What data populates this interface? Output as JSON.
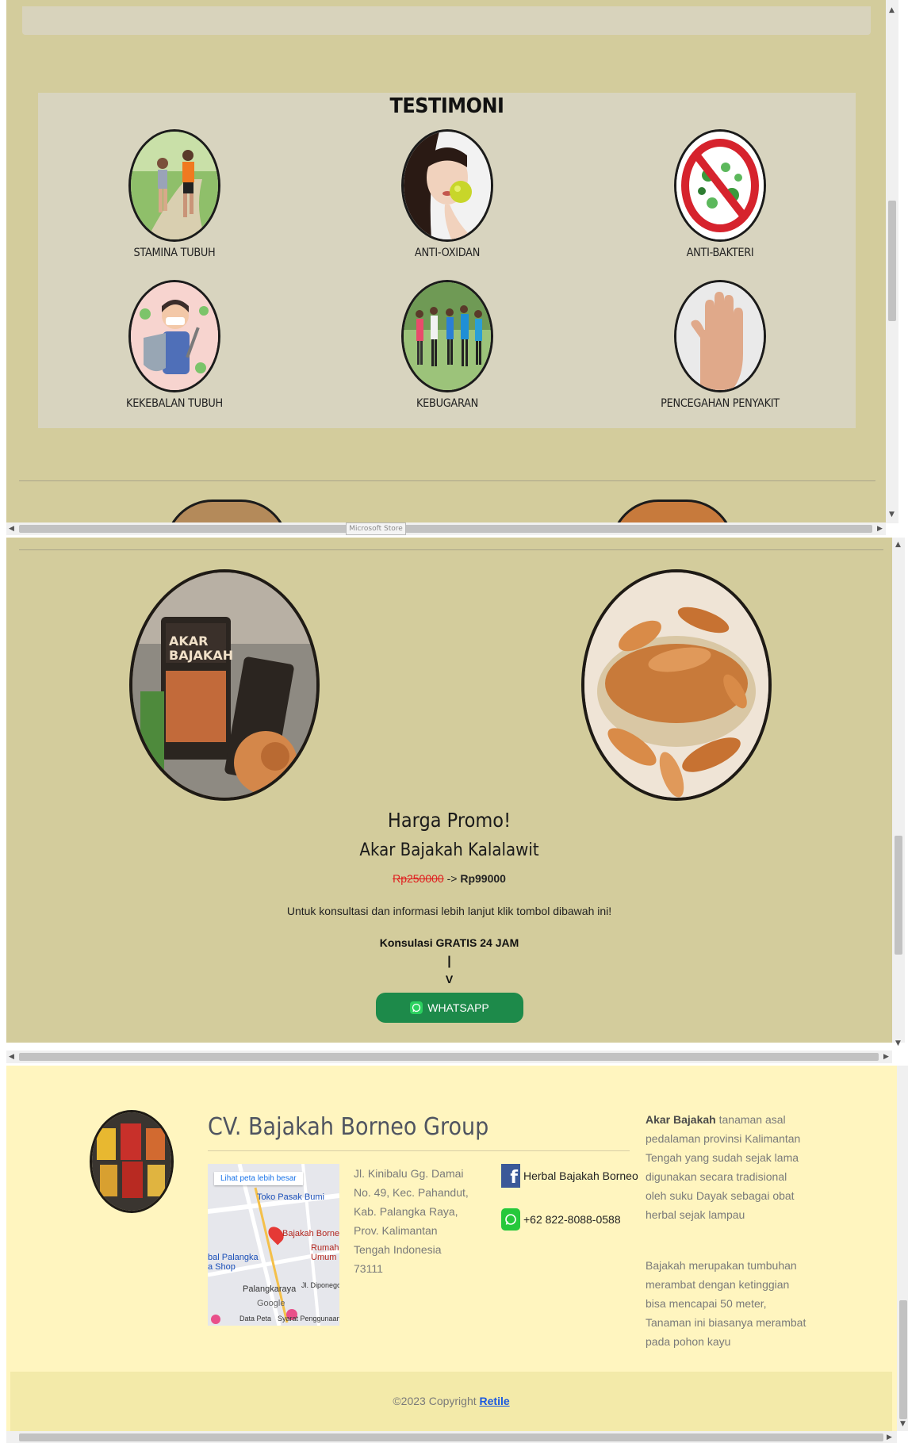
{
  "testimoni": {
    "title": "TESTIMONI",
    "items": [
      {
        "label": "STAMINA TUBUH"
      },
      {
        "label": "ANTI-OXIDAN"
      },
      {
        "label": "ANTI-BAKTERI"
      },
      {
        "label": "KEKEBALAN TUBUH"
      },
      {
        "label": "KEBUGARAN"
      },
      {
        "label": "PENCEGAHAN PENYAKIT"
      }
    ]
  },
  "window": {
    "tooltip": "Microsoft Store"
  },
  "promo": {
    "title": "Harga Promo!",
    "product": "Akar Bajakah Kalalawit",
    "price_old": "Rp250000",
    "price_arrow": "->",
    "price_new": "Rp99000",
    "info": "Untuk konsultasi dan informasi lebih lanjut klik tombol dibawah ini!",
    "konsul": "Konsulasi GRATIS 24 JAM",
    "pipe": "|",
    "arrow_v": "V",
    "whatsapp_label": "WHATSAPP",
    "image_text": [
      "AKAR",
      "BAJAKAH"
    ]
  },
  "footer": {
    "company": "CV. Bajakah Borneo Group",
    "map": {
      "link": "Lihat peta lebih besar",
      "labels": [
        "Toko Pasak Bumi",
        "Bajakah Borne",
        "Rumah",
        "Umum",
        "bal Palangka",
        "a Shop",
        "Palangkaraya",
        "Jl. Diponego",
        "Google",
        "Data Peta",
        "Syarat Penggunaan"
      ]
    },
    "address": "Jl. Kinibalu Gg. Damai No. 49, Kec. Pahandut, Kab. Palangka Raya, Prov. Kalimantan Tengah Indonesia 73111",
    "facebook": "Herbal Bajakah Borneo",
    "phone": "+62 822-8088-0588",
    "about_bold": "Akar Bajakah",
    "about_rest": " tanaman asal pedalaman provinsi Kalimantan Tengah yang sudah sejak lama digunakan secara tradisional oleh suku Dayak sebagai obat herbal sejak lampau",
    "about2": "Bajakah merupakan tumbuhan merambat dengan ketinggian bisa mencapai 50 meter, Tanaman ini biasanya merambat pada pohon kayu",
    "copyright": "©2023 Copyright ",
    "copyright_link": "Retile"
  },
  "colors": {
    "section_bg": "#d3cc9c",
    "card_bg": "#d8d4bf",
    "footer_bg": "#fff5bf",
    "footer_bar": "#f3eaa9",
    "whatsapp_green": "#1d8a4a",
    "price_old": "#e02020",
    "link_blue": "#1a58e0"
  },
  "icons": [
    "facebook-icon",
    "whatsapp-icon",
    "map-pin-icon",
    "scroll-arrow-icon"
  ]
}
